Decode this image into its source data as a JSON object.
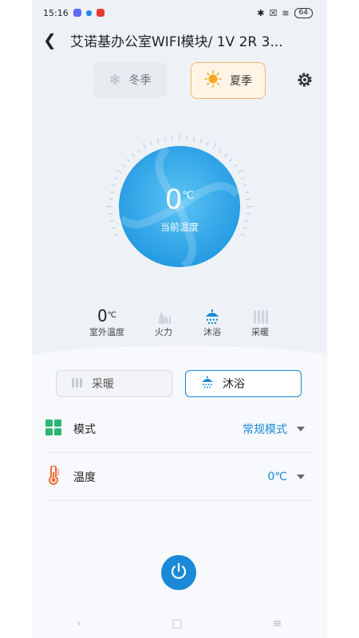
{
  "status_bar": {
    "time": "15:16",
    "battery": "64"
  },
  "header": {
    "title": "艾诺基办公室WIFI模块/ 1V 2R 3..."
  },
  "seasons": {
    "winter": "冬季",
    "summer": "夏季",
    "selected": "summer"
  },
  "dial": {
    "value": "0",
    "unit": "℃",
    "label": "当前温度"
  },
  "stats": {
    "outdoor": {
      "value": "0",
      "unit": "℃",
      "label": "室外温度"
    },
    "fire": {
      "label": "火力"
    },
    "bath": {
      "label": "沐浴"
    },
    "heating": {
      "label": "采暖"
    }
  },
  "mode_buttons": {
    "heating": "采暖",
    "bath": "沐浴",
    "selected": "bath"
  },
  "settings": {
    "mode": {
      "label": "模式",
      "value": "常规模式"
    },
    "temperature": {
      "label": "温度",
      "value": "0℃"
    }
  },
  "colors": {
    "accent": "#1a8ad8",
    "summer": "#f5a623",
    "dial": "#34a9ea"
  }
}
